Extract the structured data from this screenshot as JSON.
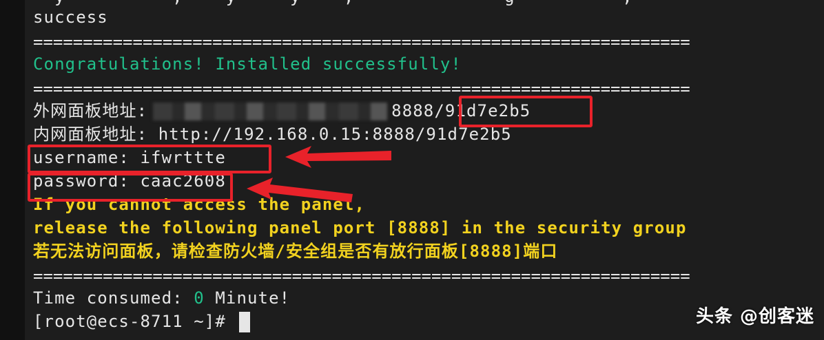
{
  "terminal": {
    "lines": {
      "success": "success",
      "separator": "==================================================================",
      "congrats": "Congratulations! Installed successfully!",
      "external_label": "外网面板地址:",
      "external_port": "8888",
      "external_suffix": "/91d7e2b5",
      "internal": "内网面板地址: http://192.168.0.15:8888/91d7e2b5",
      "username": "username: ifwrttte",
      "password": "password: caac2608",
      "warn1": "If you cannot access the panel,",
      "warn2": "release the following panel port [8888] in the security group",
      "warn3": "若无法访问面板，请检查防火墙/安全组是否有放行面板[8888]端口",
      "time_prefix": "Time consumed: ",
      "time_value": "0",
      "time_suffix": " Minute!",
      "prompt": "[root@ecs-8711 ~]# "
    },
    "colors": {
      "green": "#21c08b",
      "yellow": "#f2d21f",
      "highlight": "#e8222a"
    }
  },
  "watermark": "头条 @创客迷"
}
